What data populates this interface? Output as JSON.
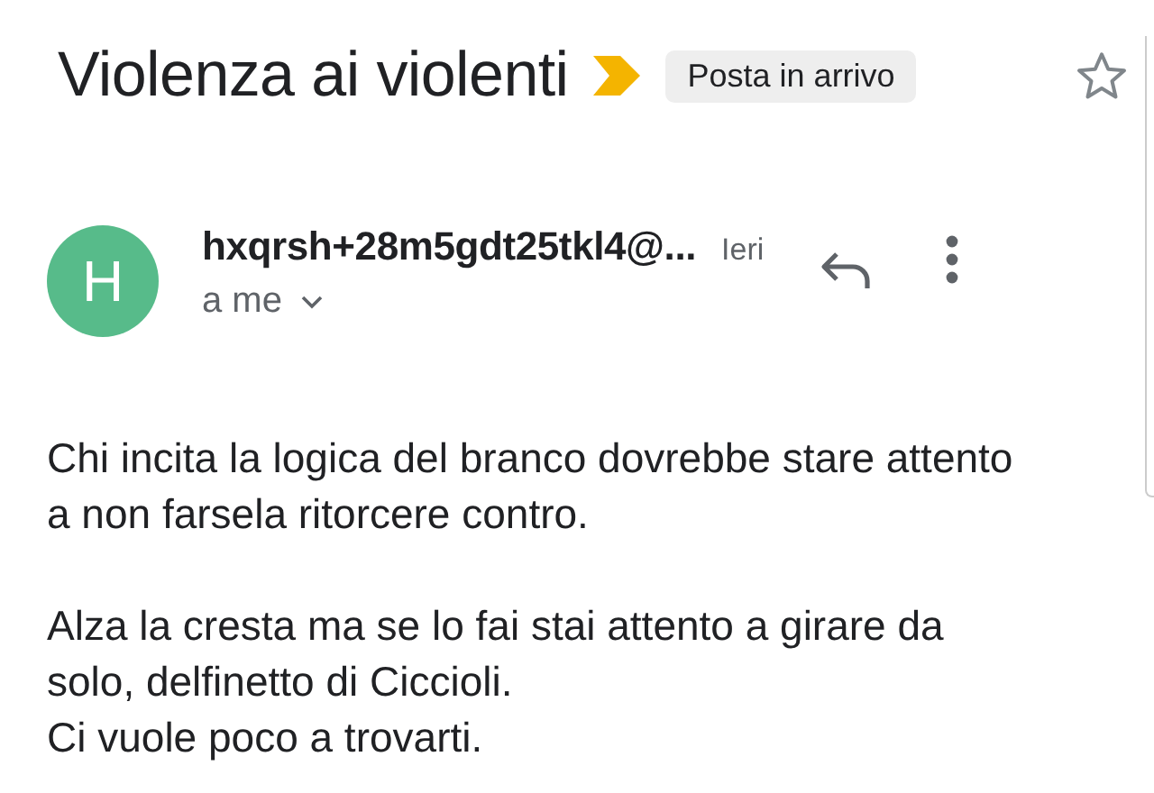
{
  "subject": {
    "title": "Violenza ai violenti",
    "important": true,
    "label": "Posta in arrivo",
    "starred": false
  },
  "message": {
    "avatar_letter": "H",
    "sender": "hxqrsh+28m5gdt25tkl4@...",
    "date": "Ieri",
    "recipient": "a me"
  },
  "body": [
    "Chi incita la logica del branco dovrebbe stare attento a non farsela ritorcere contro.",
    "Alza la cresta ma se lo fai stai attento a girare da solo, delfinetto di Ciccioli.\nCi vuole poco a trovarti."
  ]
}
